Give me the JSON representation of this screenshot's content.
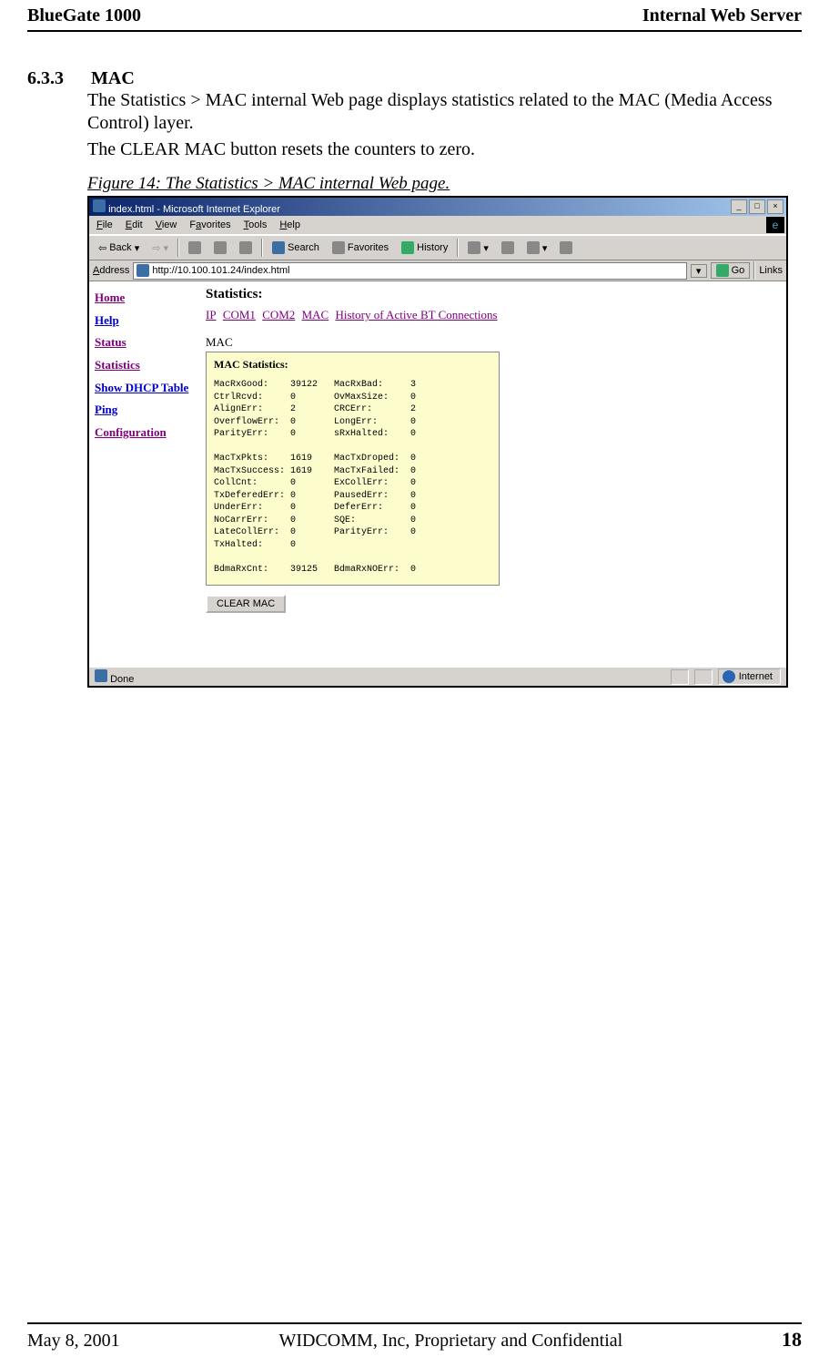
{
  "header": {
    "left": "BlueGate 1000",
    "right": "Internal Web Server"
  },
  "section": {
    "number": "6.3.3",
    "title": "MAC"
  },
  "paragraphs": {
    "p1": "The Statistics > MAC internal Web page displays statistics related to the MAC (Media Access Control) layer.",
    "p2": "The CLEAR MAC button resets the counters to zero."
  },
  "figure_caption": "Figure 14: The Statistics > MAC internal Web page.",
  "ie": {
    "title": "index.html - Microsoft Internet Explorer",
    "menus": {
      "file": "File",
      "edit": "Edit",
      "view": "View",
      "favorites": "Favorites",
      "tools": "Tools",
      "help": "Help"
    },
    "toolbar": {
      "back": "Back",
      "search": "Search",
      "favorites": "Favorites",
      "history": "History"
    },
    "address_label": "Address",
    "address_value": "http://10.100.101.24/index.html",
    "go": "Go",
    "links": "Links",
    "status_left": "Done",
    "status_zone": "Internet"
  },
  "nav": {
    "home": "Home",
    "help": "Help",
    "status": "Status",
    "statistics": "Statistics",
    "dhcp": "Show DHCP Table",
    "ping": "Ping",
    "config": "Configuration"
  },
  "main": {
    "title": "Statistics:",
    "tabs": {
      "ip": "IP",
      "com1": "COM1",
      "com2": "COM2",
      "mac": "MAC",
      "history": "History of Active BT Connections"
    },
    "mac_label": "MAC",
    "box_title": "MAC Statistics:",
    "clear_button": "CLEAR MAC"
  },
  "mac_stats": {
    "block1": [
      {
        "l": "MacRxGood:",
        "lv": "39122",
        "r": "MacRxBad:",
        "rv": "3"
      },
      {
        "l": "CtrlRcvd:",
        "lv": "0",
        "r": "OvMaxSize:",
        "rv": "0"
      },
      {
        "l": "AlignErr:",
        "lv": "2",
        "r": "CRCErr:",
        "rv": "2"
      },
      {
        "l": "OverflowErr:",
        "lv": "0",
        "r": "LongErr:",
        "rv": "0"
      },
      {
        "l": "ParityErr:",
        "lv": "0",
        "r": "sRxHalted:",
        "rv": "0"
      }
    ],
    "block2": [
      {
        "l": "MacTxPkts:",
        "lv": "1619",
        "r": "MacTxDroped:",
        "rv": "0"
      },
      {
        "l": "MacTxSuccess:",
        "lv": "1619",
        "r": "MacTxFailed:",
        "rv": "0"
      },
      {
        "l": "CollCnt:",
        "lv": "0",
        "r": "ExCollErr:",
        "rv": "0"
      },
      {
        "l": "TxDeferedErr:",
        "lv": "0",
        "r": "PausedErr:",
        "rv": "0"
      },
      {
        "l": "UnderErr:",
        "lv": "0",
        "r": "DeferErr:",
        "rv": "0"
      },
      {
        "l": "NoCarrErr:",
        "lv": "0",
        "r": "SQE:",
        "rv": "0"
      },
      {
        "l": "LateCollErr:",
        "lv": "0",
        "r": "ParityErr:",
        "rv": "0"
      },
      {
        "l": "TxHalted:",
        "lv": "0",
        "r": "",
        "rv": ""
      }
    ],
    "block3": [
      {
        "l": "BdmaRxCnt:",
        "lv": "39125",
        "r": "BdmaRxNOErr:",
        "rv": "0"
      }
    ]
  },
  "footer": {
    "date": "May 8, 2001",
    "center": "WIDCOMM, Inc, Proprietary and Confidential",
    "page": "18"
  }
}
